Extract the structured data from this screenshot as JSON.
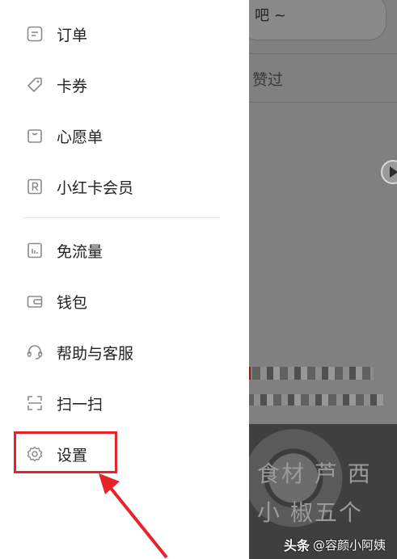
{
  "background": {
    "search_text": "吧 ~",
    "liked_text": "赞过",
    "photo_text_1": "食材  芦   西",
    "photo_text_2": "小   椒五个"
  },
  "menu": {
    "items": [
      {
        "label": "订单",
        "icon": "order-icon"
      },
      {
        "label": "卡券",
        "icon": "coupon-tag-icon"
      },
      {
        "label": "心愿单",
        "icon": "wishlist-bag-icon"
      },
      {
        "label": "小红卡会员",
        "icon": "membership-r-icon"
      },
      {
        "label": "免流量",
        "icon": "free-data-icon"
      },
      {
        "label": "钱包",
        "icon": "wallet-icon"
      },
      {
        "label": "帮助与客服",
        "icon": "headset-icon"
      },
      {
        "label": "扫一扫",
        "icon": "scan-icon"
      },
      {
        "label": "设置",
        "icon": "gear-icon"
      }
    ]
  },
  "colors": {
    "highlight": "#e8232a",
    "overlay": "#808080"
  },
  "watermark": {
    "logo": "头条",
    "text": "@容颜小阿姨"
  }
}
